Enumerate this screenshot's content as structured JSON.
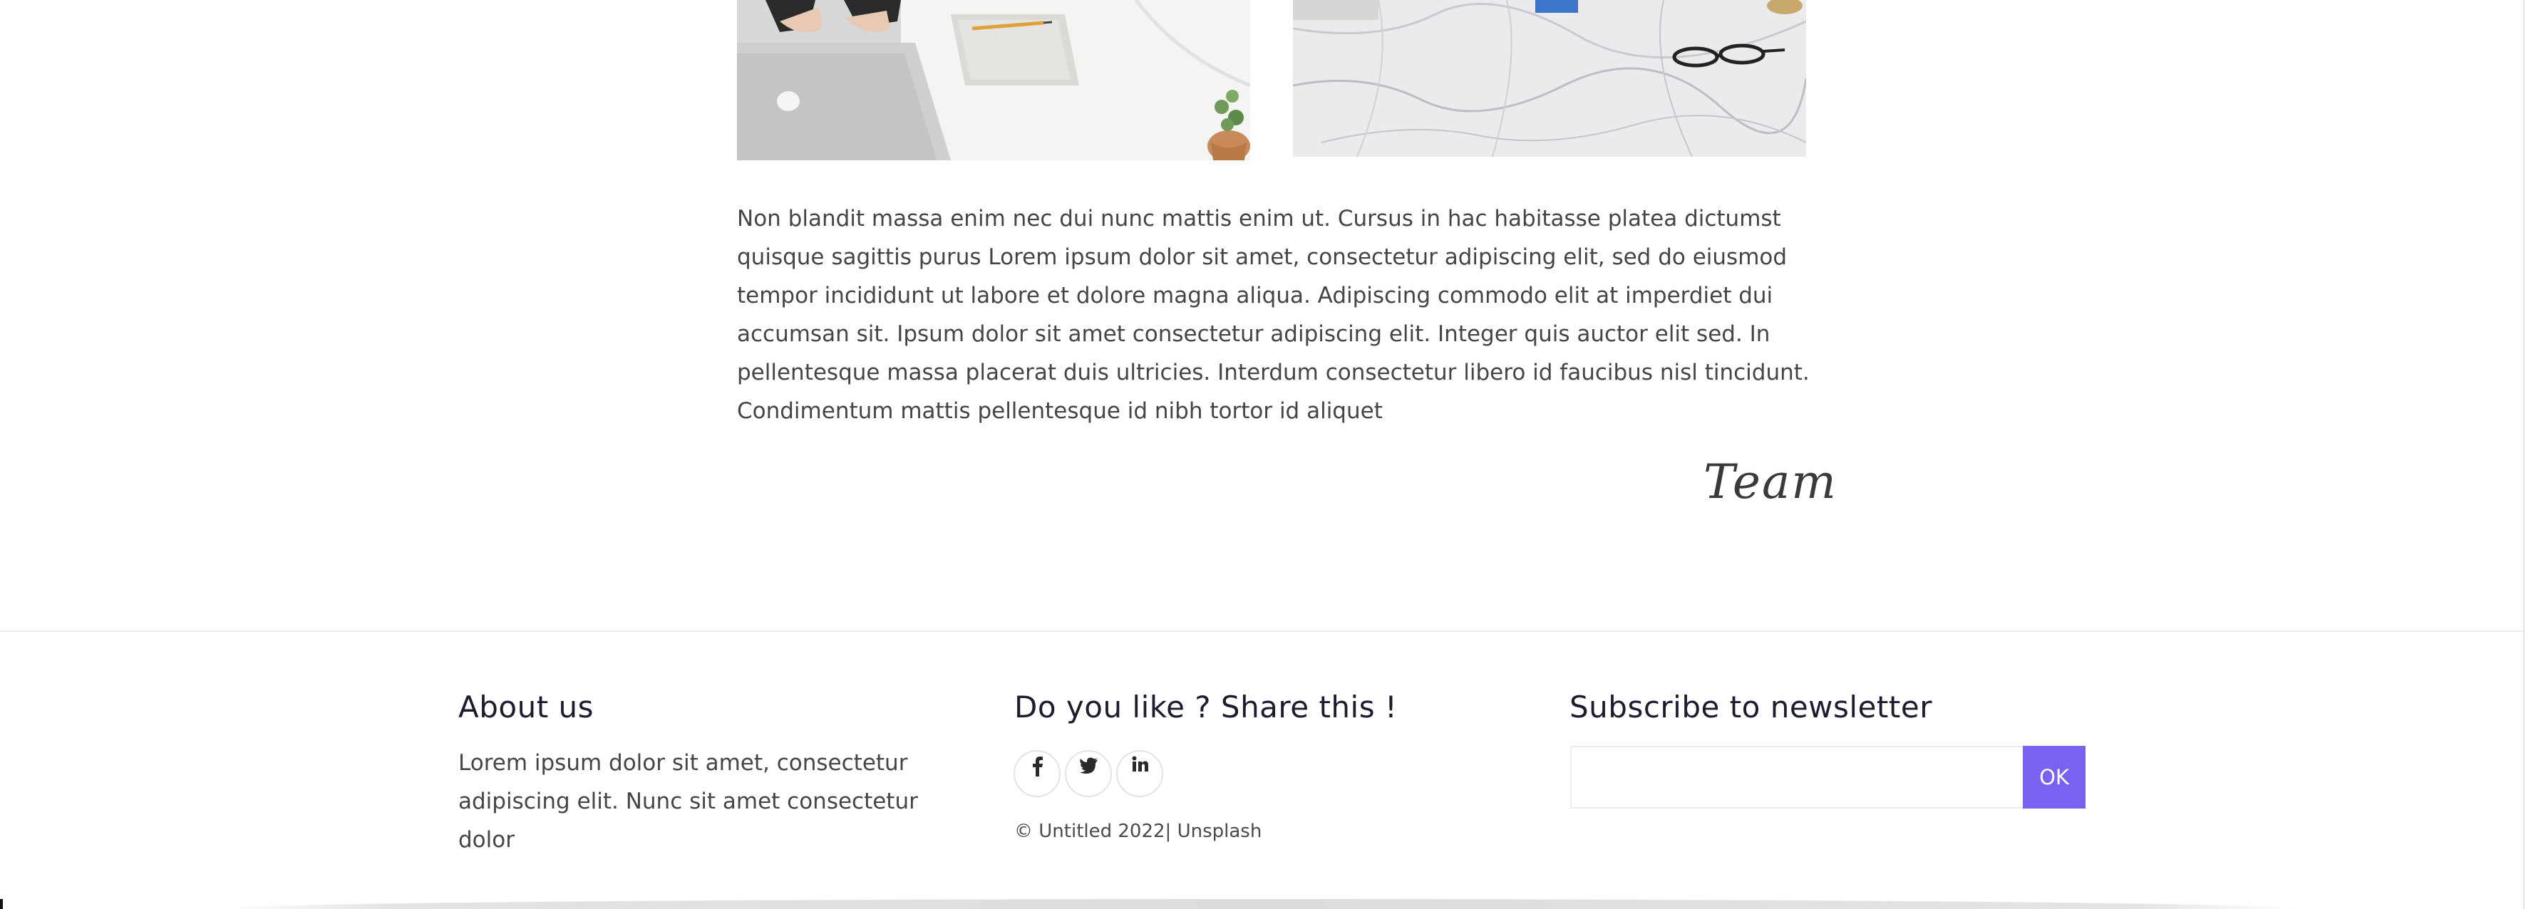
{
  "photos": {
    "laptop": "workspace-laptop-photo",
    "marble": "marble-desk-glasses-photo"
  },
  "article": {
    "body": "Non blandit massa enim nec dui nunc mattis enim ut. Cursus in hac habitasse platea dictumst quisque sagittis purus Lorem ipsum dolor sit amet, consectetur adipiscing elit, sed do eiusmod tempor incididunt ut labore et dolore magna aliqua. Adipiscing commodo elit at imperdiet dui accumsan sit. Ipsum dolor sit amet consectetur adipiscing elit. Integer quis auctor elit sed. In pellentesque massa placerat duis ultricies. Interdum consectetur libero id faucibus nisl tincidunt. Condimentum mattis pellentesque id nibh tortor id aliquet",
    "signature": "Team"
  },
  "footer": {
    "about": {
      "heading": "About us",
      "text": "Lorem ipsum dolor sit amet, consectetur adipiscing elit. Nunc sit amet consectetur dolor"
    },
    "share": {
      "heading": "Do you like ? Share this !",
      "icons": [
        "facebook-icon",
        "twitter-icon",
        "linkedin-icon"
      ],
      "copyright": "© Untitled 2022| Unsplash"
    },
    "newsletter": {
      "heading": "Subscribe to newsletter",
      "input_value": "",
      "button_label": "OK"
    }
  },
  "colors": {
    "accent": "#7b61f0",
    "heading": "#1c1c2e",
    "text": "#454545",
    "border": "#ececec"
  }
}
